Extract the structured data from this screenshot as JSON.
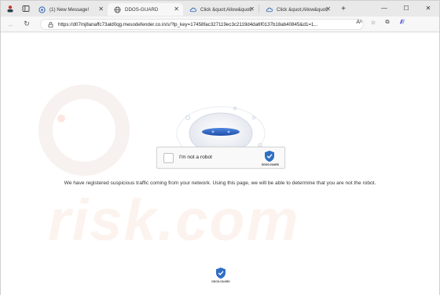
{
  "tabs": [
    {
      "label": "(1) New Message!",
      "icon": "message-icon"
    },
    {
      "label": "DDOS-GUARD",
      "icon": "globe-icon",
      "active": true
    },
    {
      "label": "Click &quot;Allow&quot;",
      "icon": "cloud-icon"
    },
    {
      "label": "Click &quot;Allow&quot;",
      "icon": "cloud-icon"
    }
  ],
  "toolbar": {
    "url": "https://d07mj8anaffc73ald0qg.mesodefender.co.in/s/?lp_key=17458fac327119ec3c2119d4da6f0137b18ab40845&d1=1..."
  },
  "captcha": {
    "label": "I'm not a robot",
    "brand": "DDOS-GUARD"
  },
  "page": {
    "message": "We have registered suspicious traffic coming from your network. Using this page, we will be able to determine that you are not the robot.",
    "watermark": "risk.com",
    "footer_brand": "DDOS-GUARD"
  },
  "colors": {
    "accent": "#2a64b8",
    "shield": "#2f6fc4",
    "watermark": "#f6ddd3"
  }
}
